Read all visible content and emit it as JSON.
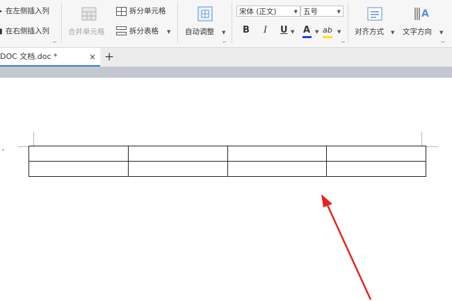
{
  "ribbon": {
    "insert_col_left": "在左侧插入列",
    "insert_col_right": "在右侧插入列",
    "merge_cells": "合并单元格",
    "split_cells": "拆分单元格",
    "split_table": "拆分表格",
    "auto_adjust": "自动调整",
    "font_name": "宋体 (正文)",
    "font_size": "五号",
    "bold": "B",
    "italic": "I",
    "underline": "U",
    "font_color": "A",
    "highlight": "ab",
    "align": "对齐方式",
    "text_direction": "文字方向"
  },
  "tabs": {
    "doc_title": "DOC 文档.doc *",
    "close": "×",
    "new": "+"
  },
  "table": {
    "rows": 2,
    "cols": 4
  },
  "colors": {
    "font_color_bar": "#1f3fd6",
    "highlight_bar": "#ffe600",
    "arrow": "#e8231d",
    "tab_accent": "#2e7de1"
  }
}
